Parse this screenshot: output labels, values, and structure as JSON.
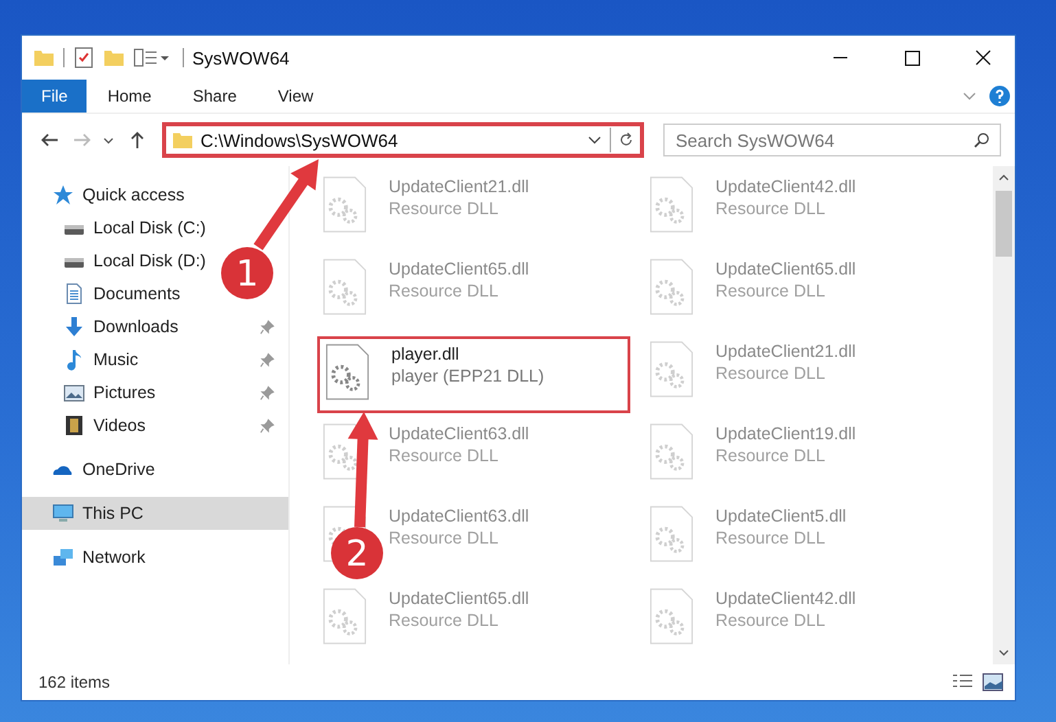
{
  "window": {
    "title": "SysWOW64"
  },
  "ribbon_tabs": [
    {
      "label": "File",
      "selected": true
    },
    {
      "label": "Home",
      "selected": false
    },
    {
      "label": "Share",
      "selected": false
    },
    {
      "label": "View",
      "selected": false
    }
  ],
  "address_bar": {
    "path": "C:\\Windows\\SysWOW64",
    "highlighted": true
  },
  "search": {
    "placeholder": "Search SysWOW64"
  },
  "sidebar": {
    "items": [
      {
        "label": "Quick access",
        "kind": "star",
        "selected": false,
        "children": [
          {
            "label": "Local Disk (C:)",
            "kind": "drive",
            "pinned": false,
            "selected": false
          },
          {
            "label": "Local Disk (D:)",
            "kind": "drive",
            "pinned": false,
            "selected": false
          },
          {
            "label": "Documents",
            "kind": "document",
            "pinned": false,
            "selected": false
          },
          {
            "label": "Downloads",
            "kind": "download",
            "pinned": true,
            "selected": false
          },
          {
            "label": "Music",
            "kind": "music",
            "pinned": true,
            "selected": false
          },
          {
            "label": "Pictures",
            "kind": "pictures",
            "pinned": true,
            "selected": false
          },
          {
            "label": "Videos",
            "kind": "videos",
            "pinned": true,
            "selected": false
          }
        ]
      },
      {
        "label": "OneDrive",
        "kind": "cloud",
        "selected": false
      },
      {
        "label": "This PC",
        "kind": "pc",
        "selected": true
      },
      {
        "label": "Network",
        "kind": "network",
        "selected": false
      }
    ]
  },
  "files": [
    {
      "name": "UpdateClient21.dll",
      "type": "Resource DLL",
      "dimmed": true,
      "highlighted": false
    },
    {
      "name": "UpdateClient42.dll",
      "type": "Resource DLL",
      "dimmed": true,
      "highlighted": false
    },
    {
      "name": "UpdateClient65.dll",
      "type": "Resource DLL",
      "dimmed": true,
      "highlighted": false
    },
    {
      "name": "UpdateClient65.dll",
      "type": "Resource DLL",
      "dimmed": true,
      "highlighted": false
    },
    {
      "name": "player.dll",
      "type": "player (EPP21 DLL)",
      "dimmed": false,
      "highlighted": true
    },
    {
      "name": "UpdateClient21.dll",
      "type": "Resource DLL",
      "dimmed": true,
      "highlighted": false
    },
    {
      "name": "UpdateClient63.dll",
      "type": "Resource DLL",
      "dimmed": true,
      "highlighted": false
    },
    {
      "name": "UpdateClient19.dll",
      "type": "Resource DLL",
      "dimmed": true,
      "highlighted": false
    },
    {
      "name": "UpdateClient63.dll",
      "type": "Resource DLL",
      "dimmed": true,
      "highlighted": false
    },
    {
      "name": "UpdateClient5.dll",
      "type": "Resource DLL",
      "dimmed": true,
      "highlighted": false
    },
    {
      "name": "UpdateClient65.dll",
      "type": "Resource DLL",
      "dimmed": true,
      "highlighted": false
    },
    {
      "name": "UpdateClient42.dll",
      "type": "Resource DLL",
      "dimmed": true,
      "highlighted": false
    }
  ],
  "status_bar": {
    "item_count": "162 items"
  },
  "annotations": [
    {
      "number": "1"
    },
    {
      "number": "2"
    }
  ]
}
